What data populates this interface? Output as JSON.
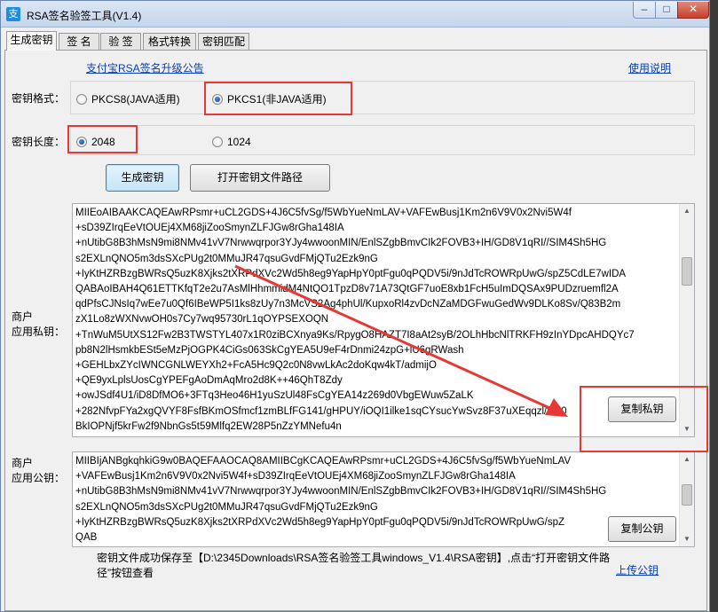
{
  "window": {
    "title": "RSA签名验签工具(V1.4)",
    "controls": {
      "minimize": "–",
      "maximize": "□",
      "close": "✕"
    }
  },
  "tabs": [
    {
      "label": "生成密钥",
      "active": true
    },
    {
      "label": "签 名",
      "active": false
    },
    {
      "label": "验 签",
      "active": false
    },
    {
      "label": "格式转换",
      "active": false
    },
    {
      "label": "密钥匹配",
      "active": false
    }
  ],
  "links": {
    "announcement": "支付宝RSA签名升级公告",
    "manual": "使用说明",
    "upload_public_key": "上传公钥"
  },
  "key_format": {
    "label": "密钥格式：",
    "options": [
      "PKCS8(JAVA适用)",
      "PKCS1(非JAVA适用)"
    ],
    "selected": "PKCS1(非JAVA适用)"
  },
  "key_length": {
    "label": "密钥长度：",
    "options": [
      "2048",
      "1024"
    ],
    "selected": "2048"
  },
  "buttons": {
    "generate": "生成密钥",
    "open_path": "打开密钥文件路径",
    "copy_private": "复制私钥",
    "copy_public": "复制公钥"
  },
  "private_key": {
    "label_line1": "商户",
    "label_line2": "应用私钥：",
    "lines": [
      "MIIEoAIBAAKCAQEAwRPsmr+uCL2GDS+4J6C5fvSg/f5WbYueNmLAV+VAFEwBusj1Km2n6V9V0x2Nvi5W4f",
      "+sD39ZIrqEeVtOUEj4XM68jiZooSmynZLFJGw8rGha148IA",
      "+nUtibG8B3hMsN9mi8NMv41vV7Nrwwqrpor3YJy4wwoonMIN/EnlSZgbBmvCIk2FOVB3+IH/GD8V1qRI//SIM4Sh5HG",
      "s2EXLnQNO5m3dsSXcPUg2t0MMuJR47qsuGvdFMjQTu2Ezk9nG",
      "+IyKtHZRBzgBWRsQ5uzK8Xjks2tXRPdXVc2Wd5h8eg9YapHpY0ptFgu0qPQDV5i/9nJdTcROWRpUwG/spZ5CdLE7wIDA",
      "QABAoIBAH4Q61ETTKfqT2e2u7AsMlHhmmidM4NtQO1TpzD8v71A73QtGF7uoE8xb1FcH5uImDQSAx9PUDzruemfl2A",
      "qdPfsCJNsIq7wEe7u0Qf6IBeWP5I1ks8zUy7n3McVS2Ag4phUl/KupxoRl4zvDcNZaMDGFwuGedWv9DLKo8Sv/Q83B2m",
      "zX1Lo8zWXNvwOH0s7Cy7wq95730rL1qOYPSEXOQN",
      "+TnWuM5UtXS12Fw2B3TWSTYL407x1R0ziBCXnya9Ks/RpygO8HAZT7I8aAt2syB/2OLhHbcNlTRKFH9zInYDpcAHDQYc7",
      "pb8N2lHsmkbESt5eMzPjOGPK4CiGs063SkCgYEA5U9eF4rDnmi24zpG+lU6gRWash",
      "+GEHLbxZYcIWNCGNLWEYXh2+FcA5Hc9Q2c0N8vwLkAc2doKqw4kT/admijO",
      "+QE9yxLplsUosCgYPEFgAoDmAqMro2d8K++46QhT8Zdy",
      "+owJSdf4U1/iD8DfMO6+3FTq3Heo46H1yuSzUl48FsCgYEA14z269d0VbgEWuw5ZaLK",
      "+282NfvpFYa2xgQVYF8FsfBKmOSfmcf1zmBLfFG141/gHPUY/iOQI1ilke1sqCYsucYwSvz8F37uXEqqzl/f950",
      "BkIOPNjf5krFw2f9NbnGs5t59Mlfq2EW28P5nZzYMNefu4n"
    ]
  },
  "public_key": {
    "label_line1": "商户",
    "label_line2": "应用公钥：",
    "lines": [
      "MIIBIjANBgkqhkiG9w0BAQEFAAOCAQ8AMIIBCgKCAQEAwRPsmr+uCL2GDS+4J6C5fvSg/f5WbYueNmLAV",
      "+VAFEwBusj1Km2n6V9V0x2Nvi5W4f+sD39ZIrqEeVtOUEj4XM68jiZooSmynZLFJGw8rGha148IA",
      "+nUtibG8B3hMsN9mi8NMv41vV7Nrwwqrpor3YJy4wwoonMIN/EnlSZgbBmvCIk2FOVB3+IH/GD8V1qRI//SIM4Sh5HG",
      "s2EXLnQNO5m3dsSXcPUg2t0MMuJR47qsuGvdFMjQTu2Ezk9nG",
      "+IyKtHZRBzgBWRsQ5uzK8Xjks2tXRPdXVc2Wd5h8eg9YapHpY0ptFgu0qPQDV5i/9nJdTcROWRpUwG/spZ",
      "QAB"
    ]
  },
  "status": {
    "message": "密钥文件成功保存至【D:\\2345Downloads\\RSA签名验签工具windows_V1.4\\RSA密钥】,点击“打开密钥文件路径”按钮查看"
  },
  "colors": {
    "annotation_red": "#e53935",
    "link_blue": "#0a3eb8"
  }
}
